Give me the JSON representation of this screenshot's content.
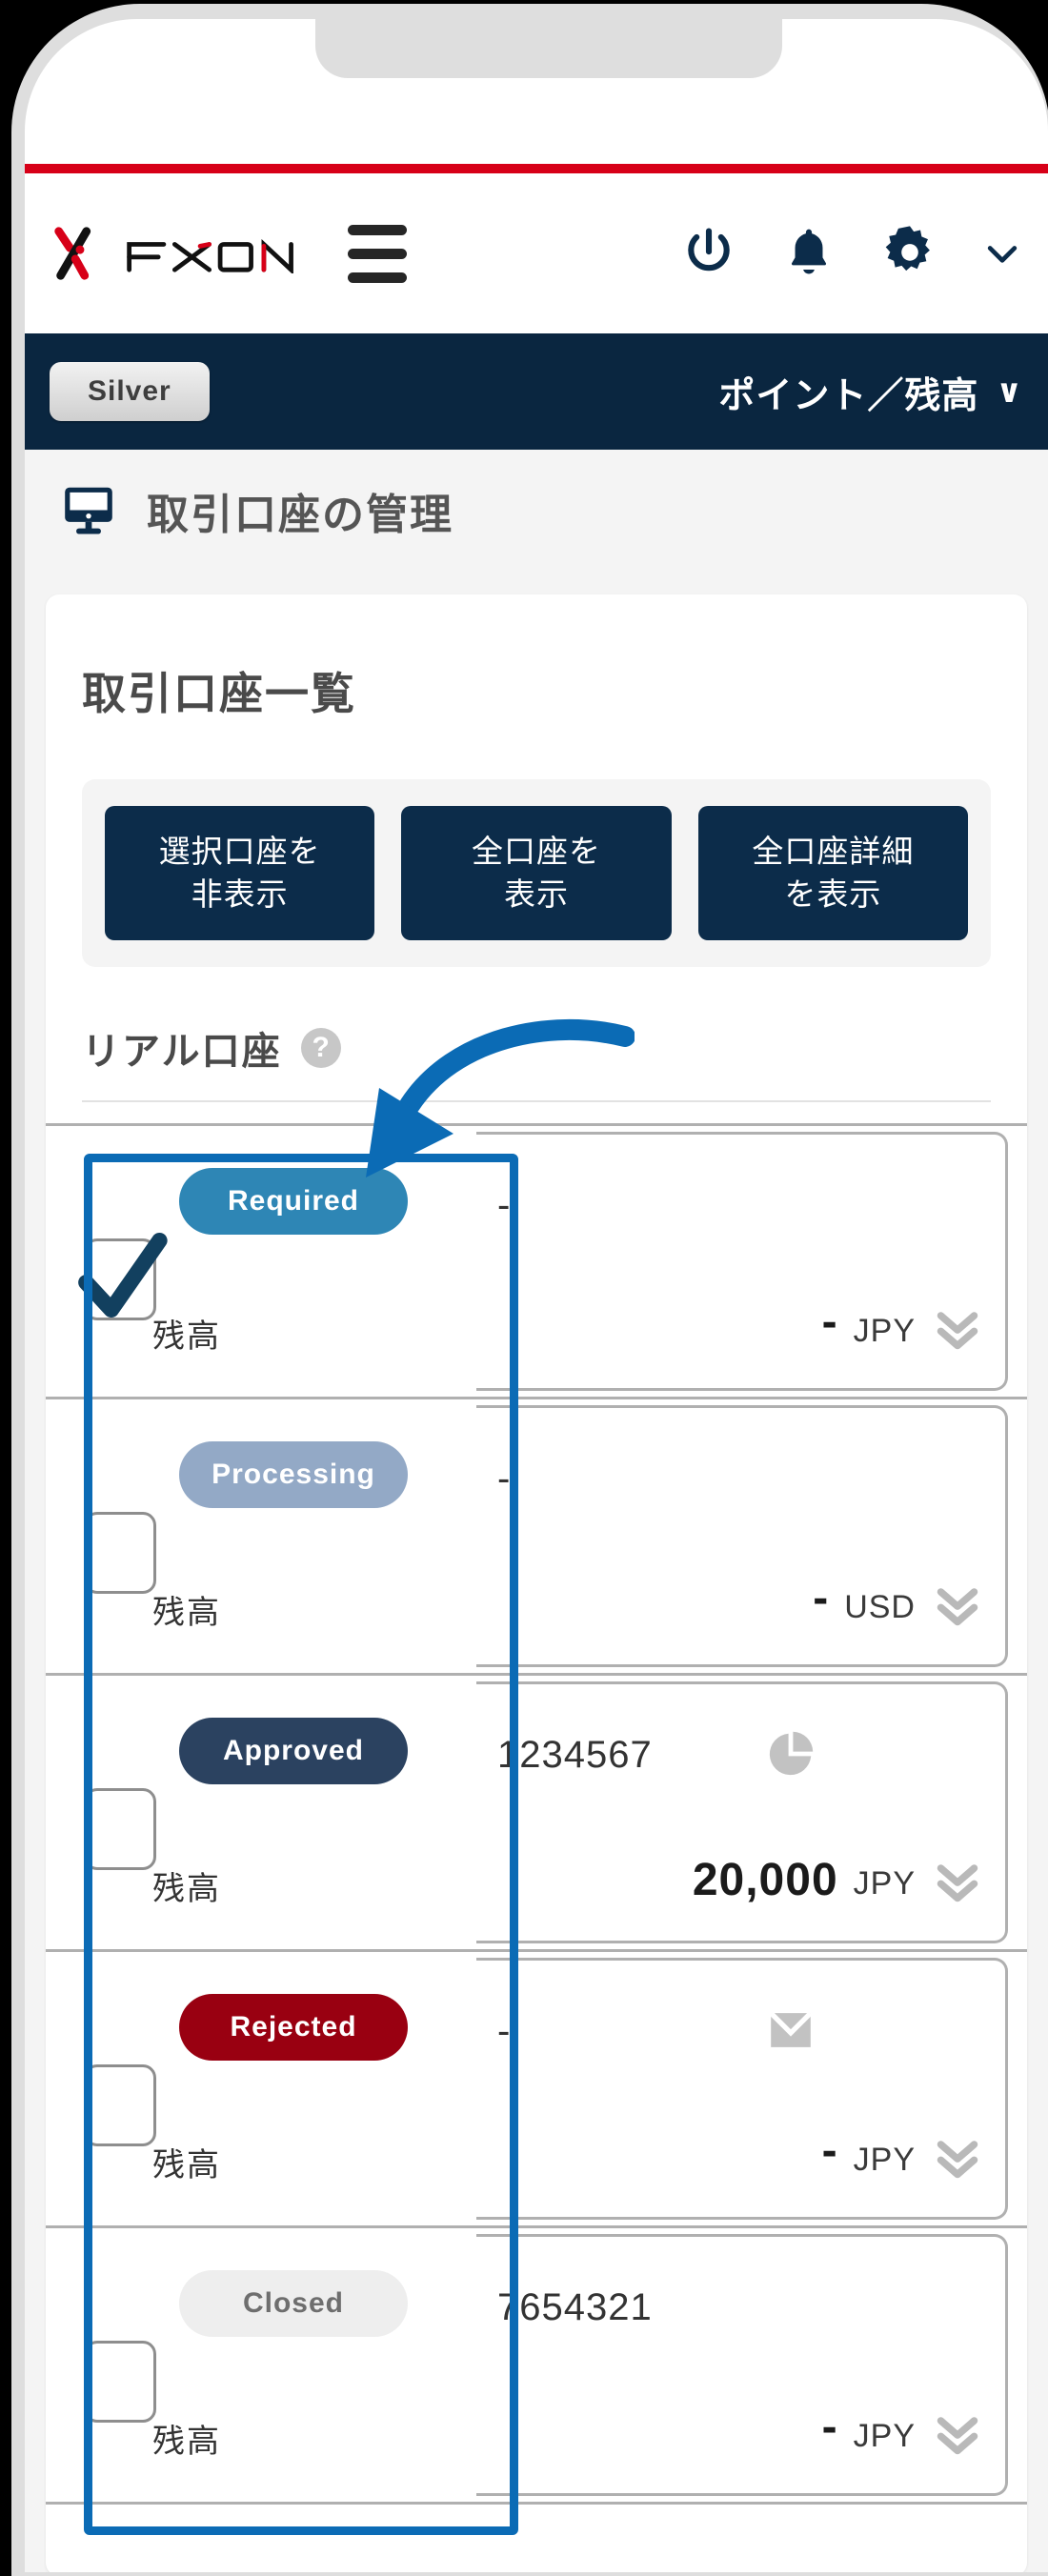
{
  "brand": {
    "name": "FXON",
    "logo_colors": {
      "red": "#d70018",
      "black": "#111111"
    }
  },
  "header": {
    "accent_rule_color": "#d70018",
    "menu_icon": "hamburger-icon",
    "actions": [
      {
        "name": "power-icon",
        "label": "Power"
      },
      {
        "name": "bell-icon",
        "label": "Notifications"
      },
      {
        "name": "gear-icon",
        "label": "Settings"
      },
      {
        "name": "chevron-down-icon",
        "label": "More"
      }
    ]
  },
  "navbar": {
    "rank_chip": "Silver",
    "points_balance_label": "ポイント／残高",
    "chevron": "∨",
    "background": "#0a2640"
  },
  "page": {
    "icon": "monitor-icon",
    "title": "取引口座の管理"
  },
  "card": {
    "title": "取引口座一覧",
    "buttons": [
      {
        "name": "hide-selected-accounts-button",
        "line1": "選択口座を",
        "line2": "非表示"
      },
      {
        "name": "show-all-accounts-button",
        "line1": "全口座を",
        "line2": "表示"
      },
      {
        "name": "show-all-account-details-button",
        "line1": "全口座詳細",
        "line2": "を表示"
      }
    ],
    "section": {
      "label": "リアル口座",
      "help_icon": "question-mark-icon",
      "help_glyph": "?"
    }
  },
  "accounts": [
    {
      "status": "Required",
      "status_class": "required",
      "status_color": "#2e86b5",
      "checked": true,
      "account_no": "-",
      "balance_label": "残高",
      "balance": "-",
      "currency": "JPY",
      "right_icon": "none",
      "expand_icon": "double-chevron-down-icon"
    },
    {
      "status": "Processing",
      "status_class": "processing",
      "status_color": "#93a9c6",
      "checked": false,
      "account_no": "-",
      "balance_label": "残高",
      "balance": "-",
      "currency": "USD",
      "right_icon": "none",
      "expand_icon": "double-chevron-down-icon"
    },
    {
      "status": "Approved",
      "status_class": "approved",
      "status_color": "#2b4260",
      "checked": false,
      "account_no": "1234567",
      "balance_label": "残高",
      "balance": "20,000",
      "currency": "JPY",
      "right_icon": "pie-chart-icon",
      "expand_icon": "double-chevron-down-icon"
    },
    {
      "status": "Rejected",
      "status_class": "rejected",
      "status_color": "#990011",
      "checked": false,
      "account_no": "-",
      "balance_label": "残高",
      "balance": "-",
      "currency": "JPY",
      "right_icon": "mail-icon",
      "expand_icon": "double-chevron-down-icon"
    },
    {
      "status": "Closed",
      "status_class": "closed",
      "status_color": "#eeeeee",
      "checked": false,
      "account_no": "7654321",
      "balance_label": "残高",
      "balance": "-",
      "currency": "JPY",
      "right_icon": "none",
      "expand_icon": "double-chevron-down-icon"
    }
  ],
  "annotation": {
    "highlight_color": "#0b6bb5",
    "arrow": "curved-arrow-pointing-down-left"
  }
}
